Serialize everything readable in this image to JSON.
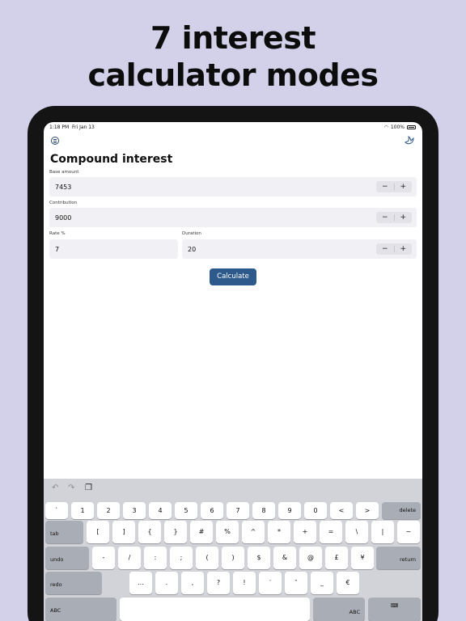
{
  "headline": {
    "line1": "7 interest",
    "line2": "calculator modes"
  },
  "status": {
    "time": "1:18 PM",
    "date": "Fri Jan 13",
    "battery": "100%"
  },
  "app": {
    "title": "Compound interest"
  },
  "fields": {
    "base_amount": {
      "label": "Base amount",
      "value": "7453"
    },
    "contribution": {
      "label": "Contribution",
      "value": "9000"
    },
    "rate": {
      "label": "Rate %",
      "value": "7"
    },
    "duration": {
      "label": "Duration",
      "value": "20"
    }
  },
  "stepper": {
    "minus": "−",
    "plus": "+"
  },
  "calculate_label": "Calculate",
  "keyboard": {
    "row1": [
      "`",
      "1",
      "2",
      "3",
      "4",
      "5",
      "6",
      "7",
      "8",
      "9",
      "0",
      "<",
      ">"
    ],
    "delete": "delete",
    "tab": "tab",
    "row2": [
      "[",
      "]",
      "{",
      "}",
      "#",
      "%",
      "^",
      "*",
      "+",
      "=",
      "\\",
      "|",
      "~"
    ],
    "undo": "undo",
    "row3": [
      "-",
      "/",
      ":",
      ";",
      "(",
      ")",
      "$",
      "&",
      "@",
      "£",
      "¥"
    ],
    "return": "return",
    "redo": "redo",
    "row4": [
      "…",
      ".",
      ",",
      "?",
      "!",
      "′",
      "″",
      "_",
      "€"
    ],
    "abc_left": "ABC",
    "abc_right": "ABC"
  }
}
